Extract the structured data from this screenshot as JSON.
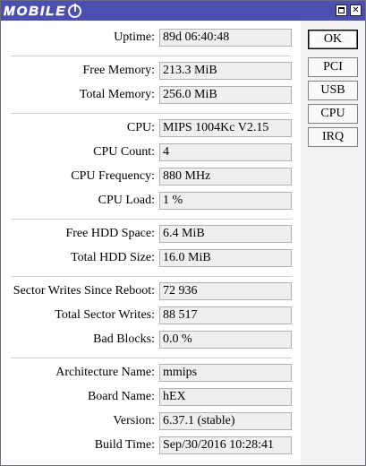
{
  "window": {
    "logo_text": "MOBILE",
    "close_glyph": "✕"
  },
  "buttons": {
    "ok": "OK",
    "pci": "PCI",
    "usb": "USB",
    "cpu": "CPU",
    "irq": "IRQ"
  },
  "fields": [
    {
      "label": "Uptime:",
      "value": "89d 06:40:48"
    },
    {
      "label": "Free Memory:",
      "value": "213.3 MiB"
    },
    {
      "label": "Total Memory:",
      "value": "256.0 MiB"
    },
    {
      "label": "CPU:",
      "value": "MIPS 1004Kc V2.15"
    },
    {
      "label": "CPU Count:",
      "value": "4"
    },
    {
      "label": "CPU Frequency:",
      "value": "880 MHz"
    },
    {
      "label": "CPU Load:",
      "value": "1 %"
    },
    {
      "label": "Free HDD Space:",
      "value": "6.4 MiB"
    },
    {
      "label": "Total HDD Size:",
      "value": "16.0 MiB"
    },
    {
      "label": "Sector Writes Since Reboot:",
      "value": "72 936"
    },
    {
      "label": "Total Sector Writes:",
      "value": "88 517"
    },
    {
      "label": "Bad Blocks:",
      "value": "0.0 %"
    },
    {
      "label": "Architecture Name:",
      "value": "mmips"
    },
    {
      "label": "Board Name:",
      "value": "hEX"
    },
    {
      "label": "Version:",
      "value": "6.37.1 (stable)"
    },
    {
      "label": "Build Time:",
      "value": "Sep/30/2016 10:28:41"
    }
  ]
}
